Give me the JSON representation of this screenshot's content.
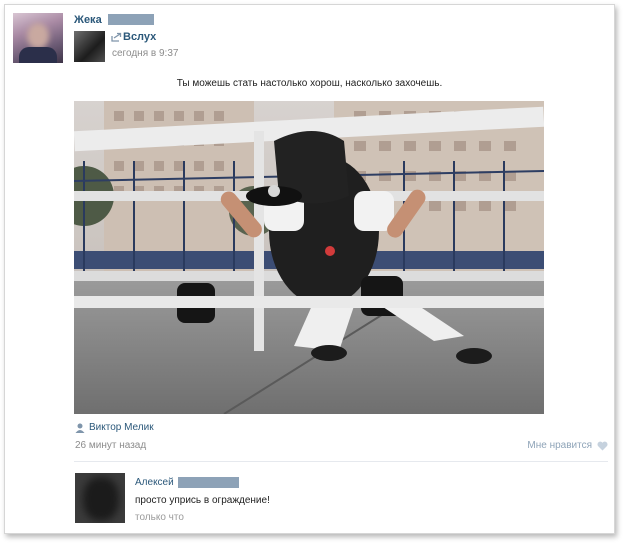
{
  "post": {
    "author": "Жека",
    "repost": {
      "source": "Вслух",
      "time": "сегодня в 9:37"
    },
    "text": "Ты можешь стать настолько хорош, насколько захочешь.",
    "photo": {
      "author": "Виктор Мелик",
      "time": "26 минут назад",
      "like_label": "Мне нравится"
    }
  },
  "comment": {
    "author": "Алексей",
    "text": "просто упрись в ограждение!",
    "time": "только что"
  },
  "icons": {
    "repost": "repost-arrow-icon",
    "photo_author": "person-icon",
    "like": "heart-icon"
  },
  "colors": {
    "link": "#2b587a",
    "muted": "#8c8c8c",
    "like": "#8fa4b8"
  }
}
